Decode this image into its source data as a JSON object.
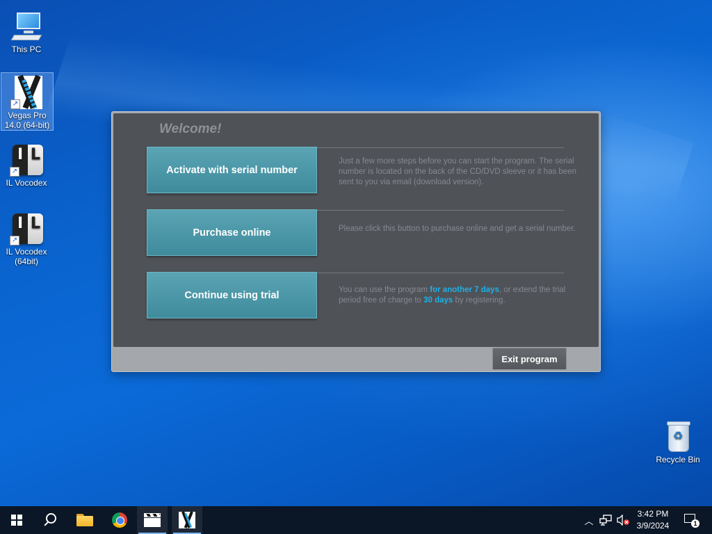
{
  "desktop": {
    "icons": [
      {
        "label": "This PC",
        "icon": "computer-icon"
      },
      {
        "label": "Vegas Pro 14.0 (64-bit)",
        "icon": "vegas-pro-icon"
      },
      {
        "label": "IL Vocodex",
        "icon": "il-vocodex-icon"
      },
      {
        "label": "IL Vocodex (64bit)",
        "icon": "il-vocodex-icon"
      },
      {
        "label": "Recycle Bin",
        "icon": "recycle-bin-icon"
      }
    ]
  },
  "dialog": {
    "welcome": "Welcome!",
    "options": [
      {
        "button": "Activate with serial number",
        "description": "Just a few more steps before you can start the program. The serial number is located on the back of the CD/DVD sleeve or it has been sent to you via email (download version)."
      },
      {
        "button": "Purchase online",
        "description": "Please click this button to purchase online and get a serial number."
      },
      {
        "button": "Continue using trial",
        "desc_part1": "You can use the program ",
        "desc_hl1": "for another 7 days",
        "desc_part2": ", or extend the trial period free of charge to ",
        "desc_hl2": "30 days",
        "desc_part3": " by registering."
      }
    ],
    "exit_button": "Exit program",
    "colors": {
      "button": "#4a97a8",
      "highlight": "#1fb0e8",
      "panel": "#4f5257"
    }
  },
  "taskbar": {
    "apps": [
      "start-icon",
      "search-icon",
      "file-explorer-icon",
      "chrome-icon",
      "clapperboard-icon",
      "vegas-pro-icon"
    ],
    "time": "3:42 PM",
    "date": "3/9/2024",
    "notification_count": "1"
  }
}
